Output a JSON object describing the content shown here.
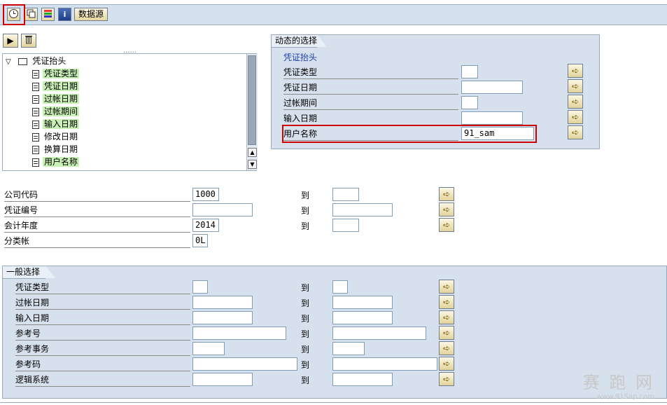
{
  "toolbar": {
    "execute_icon": "clock-execute-icon",
    "copy_icon": "copy-icon",
    "layout_icon": "color-bars-icon",
    "info_icon": "info-icon",
    "info_glyph": "i",
    "datasource_label": "数据源"
  },
  "tree_toolbar": {
    "expand_glyph": "▶",
    "delete_icon": "trash-icon"
  },
  "tree": {
    "root_label": "凭证抬头",
    "items": [
      {
        "label": "凭证类型",
        "selected": true
      },
      {
        "label": "凭证日期",
        "selected": true
      },
      {
        "label": "过帐日期",
        "selected": true
      },
      {
        "label": "过帐期间",
        "selected": true
      },
      {
        "label": "输入日期",
        "selected": true
      },
      {
        "label": "修改日期",
        "selected": false
      },
      {
        "label": "换算日期",
        "selected": false
      },
      {
        "label": "用户名称",
        "selected": true
      }
    ]
  },
  "dynamic_selection": {
    "title": "动态的选择",
    "group": "凭证抬头",
    "fields": [
      {
        "label": "凭证类型",
        "value": ""
      },
      {
        "label": "凭证日期",
        "value": ""
      },
      {
        "label": "过帐期间",
        "value": ""
      },
      {
        "label": "输入日期",
        "value": ""
      },
      {
        "label": "用户名称",
        "value": "91_sam"
      }
    ]
  },
  "header_fields": [
    {
      "label": "公司代码",
      "from": "1000",
      "to_label": "到",
      "to": ""
    },
    {
      "label": "凭证编号",
      "from": "",
      "to_label": "到",
      "to": ""
    },
    {
      "label": "会计年度",
      "from": "2014",
      "to_label": "到",
      "to": ""
    },
    {
      "label": "分类帐",
      "from": "0L"
    }
  ],
  "general": {
    "title": "一般选择",
    "fields": [
      {
        "label": "凭证类型",
        "from": "",
        "to_label": "到",
        "to": ""
      },
      {
        "label": "过帐日期",
        "from": "",
        "to_label": "到",
        "to": ""
      },
      {
        "label": "输入日期",
        "from": "",
        "to_label": "到",
        "to": ""
      },
      {
        "label": "参考号",
        "from": "",
        "to_label": "到",
        "to": ""
      },
      {
        "label": "参考事务",
        "from": "",
        "to_label": "到",
        "to": ""
      },
      {
        "label": "参考码",
        "from": "",
        "to_label": "到",
        "to": ""
      },
      {
        "label": "逻辑系统",
        "from": "",
        "to_label": "到",
        "to": ""
      }
    ]
  },
  "multiple_selection_icon": "arrow-right-icon",
  "watermark": {
    "text": "赛 跑 网",
    "url": "www.91Sap.com"
  },
  "colors": {
    "panel": "#d7e1ed",
    "highlight_red": "#d10000",
    "selected_green": "#c9f0b5"
  }
}
